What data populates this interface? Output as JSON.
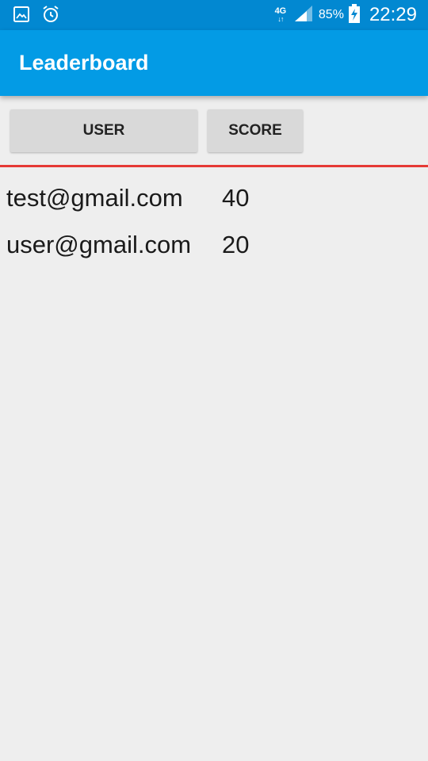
{
  "status_bar": {
    "network": "4G",
    "network_arrows": "↓↑",
    "battery": "85%",
    "time": "22:29",
    "icons": [
      "image-icon",
      "alarm-icon",
      "signal-icon",
      "battery-charging-icon"
    ]
  },
  "app_bar": {
    "title": "Leaderboard",
    "color": "#039be5"
  },
  "sort_buttons": {
    "user_label": "USER",
    "score_label": "SCORE"
  },
  "divider_color": "#e53935",
  "leaderboard": {
    "rows": [
      {
        "user": "test@gmail.com",
        "score": "40"
      },
      {
        "user": "user@gmail.com",
        "score": "20"
      }
    ]
  }
}
